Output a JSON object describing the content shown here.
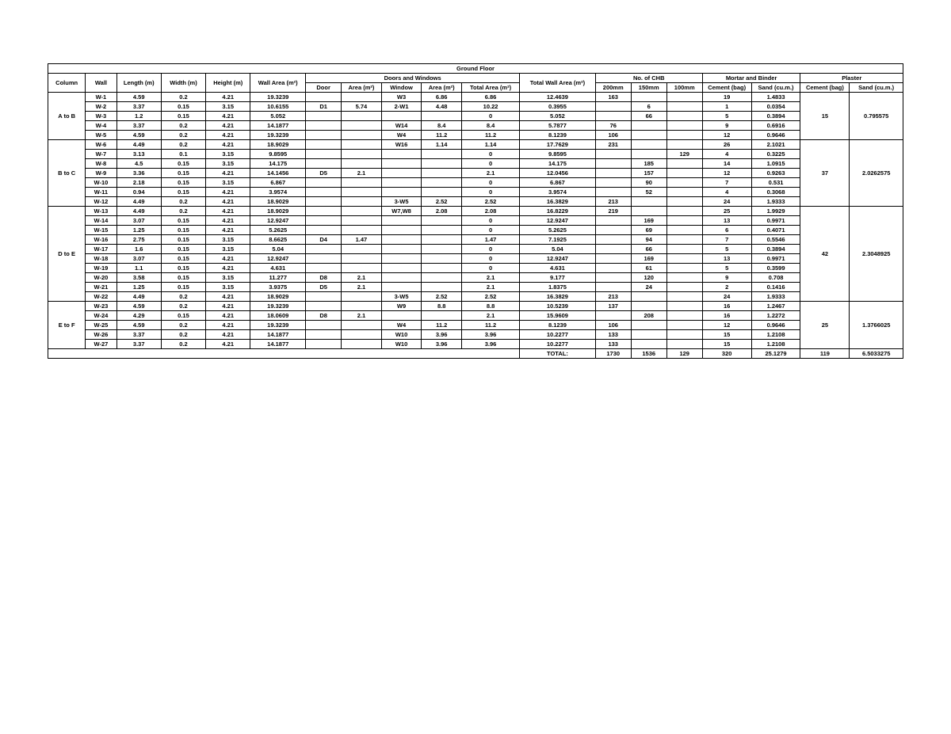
{
  "title": "Ground Floor",
  "headers": {
    "column": "Column",
    "wall": "Wall",
    "length": "Length (m)",
    "width": "Width (m)",
    "height": "Height (m)",
    "wallArea": "Wall Area (m²)",
    "doorsWindows": "Doors and Windows",
    "door": "Door",
    "area1": "Area (m²)",
    "window": "Window",
    "area2": "Area (m²)",
    "totalArea": "Total Area (m²)",
    "totalWallArea": "Total Wall Area (m²)",
    "noCHB": "No. of CHB",
    "mm200": "200mm",
    "mm150": "150mm",
    "mm100": "100mm",
    "mortarBinder": "Mortar and Binder",
    "cementBag": "Cement (bag)",
    "sand": "Sand (cu.m.)",
    "plaster": "Plaster",
    "cementBag2": "Cement (bag)",
    "sand2": "Sand (cu.m.)"
  },
  "groups": [
    {
      "column": "A to B",
      "plasterCement": "15",
      "plasterSand": "0.795575",
      "rows": [
        {
          "wall": "W-1",
          "length": "4.59",
          "width": "0.2",
          "height": "4.21",
          "wallArea": "19.3239",
          "door": "",
          "doorArea": "",
          "window": "W3",
          "winArea": "6.86",
          "totalArea": "6.86",
          "totalWallArea": "12.4639",
          "mm200": "163",
          "mm150": "",
          "mm100": "",
          "cement": "19",
          "sand": "1.4833"
        },
        {
          "wall": "W-2",
          "length": "3.37",
          "width": "0.15",
          "height": "3.15",
          "wallArea": "10.6155",
          "door": "D1",
          "doorArea": "5.74",
          "window": "2-W1",
          "winArea": "4.48",
          "totalArea": "10.22",
          "totalWallArea": "0.3955",
          "mm200": "",
          "mm150": "6",
          "mm100": "",
          "cement": "1",
          "sand": "0.0354"
        },
        {
          "wall": "W-3",
          "length": "1.2",
          "width": "0.15",
          "height": "4.21",
          "wallArea": "5.052",
          "door": "",
          "doorArea": "",
          "window": "",
          "winArea": "",
          "totalArea": "0",
          "totalWallArea": "5.052",
          "mm200": "",
          "mm150": "66",
          "mm100": "",
          "cement": "5",
          "sand": "0.3894"
        },
        {
          "wall": "W-4",
          "length": "3.37",
          "width": "0.2",
          "height": "4.21",
          "wallArea": "14.1877",
          "door": "",
          "doorArea": "",
          "window": "W14",
          "winArea": "8.4",
          "totalArea": "8.4",
          "totalWallArea": "5.7877",
          "mm200": "76",
          "mm150": "",
          "mm100": "",
          "cement": "9",
          "sand": "0.6916"
        },
        {
          "wall": "W-5",
          "length": "4.59",
          "width": "0.2",
          "height": "4.21",
          "wallArea": "19.3239",
          "door": "",
          "doorArea": "",
          "window": "W4",
          "winArea": "11.2",
          "totalArea": "11.2",
          "totalWallArea": "8.1239",
          "mm200": "106",
          "mm150": "",
          "mm100": "",
          "cement": "12",
          "sand": "0.9646"
        }
      ]
    },
    {
      "column": "B to C",
      "plasterCement": "37",
      "plasterSand": "2.0262575",
      "rows": [
        {
          "wall": "W-6",
          "length": "4.49",
          "width": "0.2",
          "height": "4.21",
          "wallArea": "18.9029",
          "door": "",
          "doorArea": "",
          "window": "W16",
          "winArea": "1.14",
          "totalArea": "1.14",
          "totalWallArea": "17.7629",
          "mm200": "231",
          "mm150": "",
          "mm100": "",
          "cement": "26",
          "sand": "2.1021"
        },
        {
          "wall": "W-7",
          "length": "3.13",
          "width": "0.1",
          "height": "3.15",
          "wallArea": "9.8595",
          "door": "",
          "doorArea": "",
          "window": "",
          "winArea": "",
          "totalArea": "0",
          "totalWallArea": "9.8595",
          "mm200": "",
          "mm150": "",
          "mm100": "129",
          "cement": "4",
          "sand": "0.3225"
        },
        {
          "wall": "W-8",
          "length": "4.5",
          "width": "0.15",
          "height": "3.15",
          "wallArea": "14.175",
          "door": "",
          "doorArea": "",
          "window": "",
          "winArea": "",
          "totalArea": "0",
          "totalWallArea": "14.175",
          "mm200": "",
          "mm150": "185",
          "mm100": "",
          "cement": "14",
          "sand": "1.0915"
        },
        {
          "wall": "W-9",
          "length": "3.36",
          "width": "0.15",
          "height": "4.21",
          "wallArea": "14.1456",
          "door": "D5",
          "doorArea": "2.1",
          "window": "",
          "winArea": "",
          "totalArea": "2.1",
          "totalWallArea": "12.0456",
          "mm200": "",
          "mm150": "157",
          "mm100": "",
          "cement": "12",
          "sand": "0.9263"
        },
        {
          "wall": "W-10",
          "length": "2.18",
          "width": "0.15",
          "height": "3.15",
          "wallArea": "6.867",
          "door": "",
          "doorArea": "",
          "window": "",
          "winArea": "",
          "totalArea": "0",
          "totalWallArea": "6.867",
          "mm200": "",
          "mm150": "90",
          "mm100": "",
          "cement": "7",
          "sand": "0.531"
        },
        {
          "wall": "W-11",
          "length": "0.94",
          "width": "0.15",
          "height": "4.21",
          "wallArea": "3.9574",
          "door": "",
          "doorArea": "",
          "window": "",
          "winArea": "",
          "totalArea": "0",
          "totalWallArea": "3.9574",
          "mm200": "",
          "mm150": "52",
          "mm100": "",
          "cement": "4",
          "sand": "0.3068"
        },
        {
          "wall": "W-12",
          "length": "4.49",
          "width": "0.2",
          "height": "4.21",
          "wallArea": "18.9029",
          "door": "",
          "doorArea": "",
          "window": "3-W5",
          "winArea": "2.52",
          "totalArea": "2.52",
          "totalWallArea": "16.3829",
          "mm200": "213",
          "mm150": "",
          "mm100": "",
          "cement": "24",
          "sand": "1.9333"
        }
      ]
    },
    {
      "column": "D to E",
      "plasterCement": "42",
      "plasterSand": "2.3048925",
      "rows": [
        {
          "wall": "W-13",
          "length": "4.49",
          "width": "0.2",
          "height": "4.21",
          "wallArea": "18.9029",
          "door": "",
          "doorArea": "",
          "window": "W7,W8",
          "winArea": "2.08",
          "totalArea": "2.08",
          "totalWallArea": "16.8229",
          "mm200": "219",
          "mm150": "",
          "mm100": "",
          "cement": "25",
          "sand": "1.9929"
        },
        {
          "wall": "W-14",
          "length": "3.07",
          "width": "0.15",
          "height": "4.21",
          "wallArea": "12.9247",
          "door": "",
          "doorArea": "",
          "window": "",
          "winArea": "",
          "totalArea": "0",
          "totalWallArea": "12.9247",
          "mm200": "",
          "mm150": "169",
          "mm100": "",
          "cement": "13",
          "sand": "0.9971"
        },
        {
          "wall": "W-15",
          "length": "1.25",
          "width": "0.15",
          "height": "4.21",
          "wallArea": "5.2625",
          "door": "",
          "doorArea": "",
          "window": "",
          "winArea": "",
          "totalArea": "0",
          "totalWallArea": "5.2625",
          "mm200": "",
          "mm150": "69",
          "mm100": "",
          "cement": "6",
          "sand": "0.4071"
        },
        {
          "wall": "W-16",
          "length": "2.75",
          "width": "0.15",
          "height": "3.15",
          "wallArea": "8.6625",
          "door": "D4",
          "doorArea": "1.47",
          "window": "",
          "winArea": "",
          "totalArea": "1.47",
          "totalWallArea": "7.1925",
          "mm200": "",
          "mm150": "94",
          "mm100": "",
          "cement": "7",
          "sand": "0.5546"
        },
        {
          "wall": "W-17",
          "length": "1.6",
          "width": "0.15",
          "height": "3.15",
          "wallArea": "5.04",
          "door": "",
          "doorArea": "",
          "window": "",
          "winArea": "",
          "totalArea": "0",
          "totalWallArea": "5.04",
          "mm200": "",
          "mm150": "66",
          "mm100": "",
          "cement": "5",
          "sand": "0.3894"
        },
        {
          "wall": "W-18",
          "length": "3.07",
          "width": "0.15",
          "height": "4.21",
          "wallArea": "12.9247",
          "door": "",
          "doorArea": "",
          "window": "",
          "winArea": "",
          "totalArea": "0",
          "totalWallArea": "12.9247",
          "mm200": "",
          "mm150": "169",
          "mm100": "",
          "cement": "13",
          "sand": "0.9971"
        },
        {
          "wall": "W-19",
          "length": "1.1",
          "width": "0.15",
          "height": "4.21",
          "wallArea": "4.631",
          "door": "",
          "doorArea": "",
          "window": "",
          "winArea": "",
          "totalArea": "0",
          "totalWallArea": "4.631",
          "mm200": "",
          "mm150": "61",
          "mm100": "",
          "cement": "5",
          "sand": "0.3599"
        },
        {
          "wall": "W-20",
          "length": "3.58",
          "width": "0.15",
          "height": "3.15",
          "wallArea": "11.277",
          "door": "D8",
          "doorArea": "2.1",
          "window": "",
          "winArea": "",
          "totalArea": "2.1",
          "totalWallArea": "9.177",
          "mm200": "",
          "mm150": "120",
          "mm100": "",
          "cement": "9",
          "sand": "0.708"
        },
        {
          "wall": "W-21",
          "length": "1.25",
          "width": "0.15",
          "height": "3.15",
          "wallArea": "3.9375",
          "door": "D5",
          "doorArea": "2.1",
          "window": "",
          "winArea": "",
          "totalArea": "2.1",
          "totalWallArea": "1.8375",
          "mm200": "",
          "mm150": "24",
          "mm100": "",
          "cement": "2",
          "sand": "0.1416"
        },
        {
          "wall": "W-22",
          "length": "4.49",
          "width": "0.2",
          "height": "4.21",
          "wallArea": "18.9029",
          "door": "",
          "doorArea": "",
          "window": "3-W5",
          "winArea": "2.52",
          "totalArea": "2.52",
          "totalWallArea": "16.3829",
          "mm200": "213",
          "mm150": "",
          "mm100": "",
          "cement": "24",
          "sand": "1.9333"
        }
      ]
    },
    {
      "column": "E to F",
      "plasterCement": "25",
      "plasterSand": "1.3766025",
      "rows": [
        {
          "wall": "W-23",
          "length": "4.59",
          "width": "0.2",
          "height": "4.21",
          "wallArea": "19.3239",
          "door": "",
          "doorArea": "",
          "window": "W9",
          "winArea": "8.8",
          "totalArea": "8.8",
          "totalWallArea": "10.5239",
          "mm200": "137",
          "mm150": "",
          "mm100": "",
          "cement": "16",
          "sand": "1.2467"
        },
        {
          "wall": "W-24",
          "length": "4.29",
          "width": "0.15",
          "height": "4.21",
          "wallArea": "18.0609",
          "door": "D8",
          "doorArea": "2.1",
          "window": "",
          "winArea": "",
          "totalArea": "2.1",
          "totalWallArea": "15.9609",
          "mm200": "",
          "mm150": "208",
          "mm100": "",
          "cement": "16",
          "sand": "1.2272"
        },
        {
          "wall": "W-25",
          "length": "4.59",
          "width": "0.2",
          "height": "4.21",
          "wallArea": "19.3239",
          "door": "",
          "doorArea": "",
          "window": "W4",
          "winArea": "11.2",
          "totalArea": "11.2",
          "totalWallArea": "8.1239",
          "mm200": "106",
          "mm150": "",
          "mm100": "",
          "cement": "12",
          "sand": "0.9646"
        },
        {
          "wall": "W-26",
          "length": "3.37",
          "width": "0.2",
          "height": "4.21",
          "wallArea": "14.1877",
          "door": "",
          "doorArea": "",
          "window": "W10",
          "winArea": "3.96",
          "totalArea": "3.96",
          "totalWallArea": "10.2277",
          "mm200": "133",
          "mm150": "",
          "mm100": "",
          "cement": "15",
          "sand": "1.2108"
        },
        {
          "wall": "W-27",
          "length": "3.37",
          "width": "0.2",
          "height": "4.21",
          "wallArea": "14.1877",
          "door": "",
          "doorArea": "",
          "window": "W10",
          "winArea": "3.96",
          "totalArea": "3.96",
          "totalWallArea": "10.2277",
          "mm200": "133",
          "mm150": "",
          "mm100": "",
          "cement": "15",
          "sand": "1.2108"
        }
      ]
    }
  ],
  "totals": {
    "label": "TOTAL:",
    "mm200": "1730",
    "mm150": "1536",
    "mm100": "129",
    "cement": "320",
    "sand": "25.1279",
    "plasterCement": "119",
    "plasterSand": "6.5033275"
  }
}
